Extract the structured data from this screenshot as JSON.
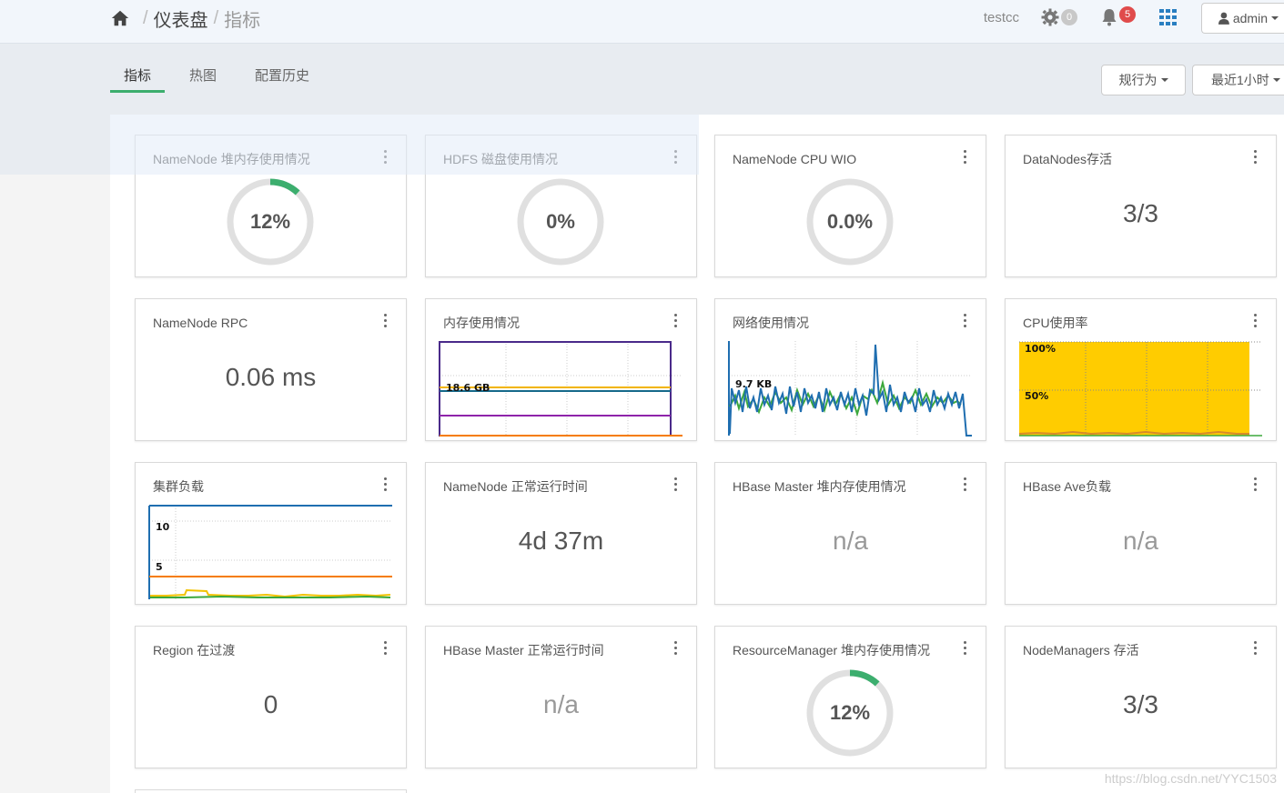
{
  "header": {
    "breadcrumb_root": "仪表盘",
    "breadcrumb_current": "指标",
    "cluster_name": "testcc",
    "ops_count": "0",
    "alert_count": "5",
    "user_label": "admin"
  },
  "tabs": [
    "指标",
    "热图",
    "配置历史"
  ],
  "toolbar": {
    "actions_label": "规行为",
    "time_range_label": "最近1小时"
  },
  "widgets": {
    "nn_heap": {
      "title": "NameNode 堆内存使用情况",
      "value": "12%",
      "percent": 12
    },
    "hdfs_disk": {
      "title": "HDFS 磁盘使用情况",
      "value": "0%",
      "percent": 0
    },
    "nn_cpu": {
      "title": "NameNode CPU WIO",
      "value": "0.0%",
      "percent": 0
    },
    "dn_live": {
      "title": "DataNodes存活",
      "value": "3/3"
    },
    "nn_rpc": {
      "title": "NameNode RPC",
      "value": "0.06 ms"
    },
    "memory": {
      "title": "内存使用情况",
      "label": "18.6 GB"
    },
    "network": {
      "title": "网络使用情况",
      "label": "9.7 KB"
    },
    "cpu": {
      "title": "CPU使用率",
      "label_100": "100%",
      "label_50": "50%"
    },
    "cluster_load": {
      "title": "集群负载",
      "label_10": "10",
      "label_5": "5"
    },
    "nn_uptime": {
      "title": "NameNode 正常运行时间",
      "value": "4d 37m"
    },
    "hb_heap": {
      "title": "HBase Master 堆内存使用情况",
      "value": "n/a"
    },
    "hb_ave": {
      "title": "HBase Ave负载",
      "value": "n/a"
    },
    "region": {
      "title": "Region 在过渡",
      "value": "0"
    },
    "hb_uptime": {
      "title": "HBase Master 正常运行时间",
      "value": "n/a"
    },
    "rm_heap": {
      "title": "ResourceManager 堆内存使用情况",
      "value": "12%",
      "percent": 12
    },
    "nm_live": {
      "title": "NodeManagers 存活",
      "value": "3/3"
    }
  },
  "colors": {
    "accent": "#3cae6e",
    "donut_track": "#e0e0e0",
    "cpu_fill": "#ffcc00",
    "net_line": "#1f6eb0",
    "mem_purple": "#6a1b9a"
  },
  "watermark": "https://blog.csdn.net/YYC1503"
}
